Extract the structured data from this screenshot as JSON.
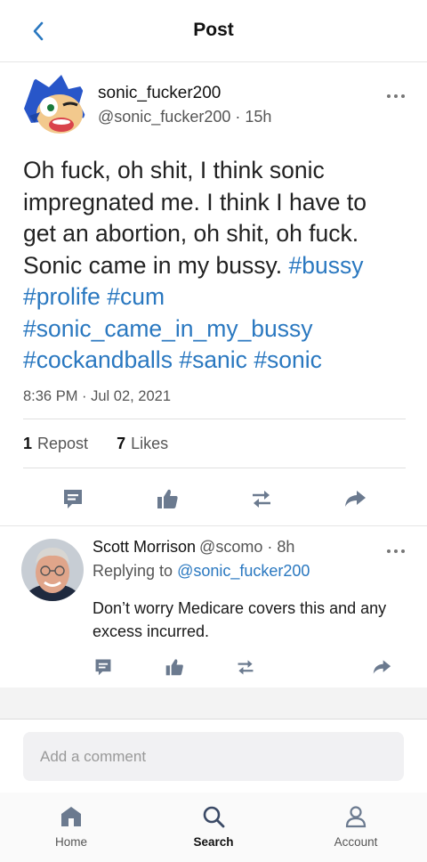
{
  "header": {
    "title": "Post",
    "back_icon": "chevron-left-icon"
  },
  "post": {
    "author_name": "sonic_fucker200",
    "author_handle": "@sonic_fucker200",
    "age": "15h",
    "body_text": "Oh fuck, oh shit, I think sonic impregnated me. I think I have to get an abortion, oh shit, oh fuck. Sonic came in my bussy.",
    "hashtags": [
      "#bussy",
      "#prolife",
      "#cum",
      "#sonic_came_in_my_bussy",
      "#cockandballs",
      "#sanic",
      "#sonic"
    ],
    "timestamp": "8:36 PM · Jul 02, 2021",
    "reposts": {
      "count": "1",
      "label": "Repost"
    },
    "likes": {
      "count": "7",
      "label": "Likes"
    }
  },
  "reply": {
    "author_name": "Scott Morrison",
    "author_handle": "@scomo",
    "age": "8h",
    "replying_prefix": "Replying to",
    "replying_to": "@sonic_fucker200",
    "body_text": "Don’t worry Medicare covers this and any excess incurred."
  },
  "comment": {
    "placeholder": "Add a comment"
  },
  "tabs": [
    {
      "label": "Home",
      "icon": "home-icon"
    },
    {
      "label": "Search",
      "icon": "search-icon",
      "active": true
    },
    {
      "label": "Account",
      "icon": "account-icon"
    }
  ],
  "colors": {
    "accent": "#2a78c0",
    "icon": "#6b7a8f",
    "text": "#1a1a1a"
  }
}
